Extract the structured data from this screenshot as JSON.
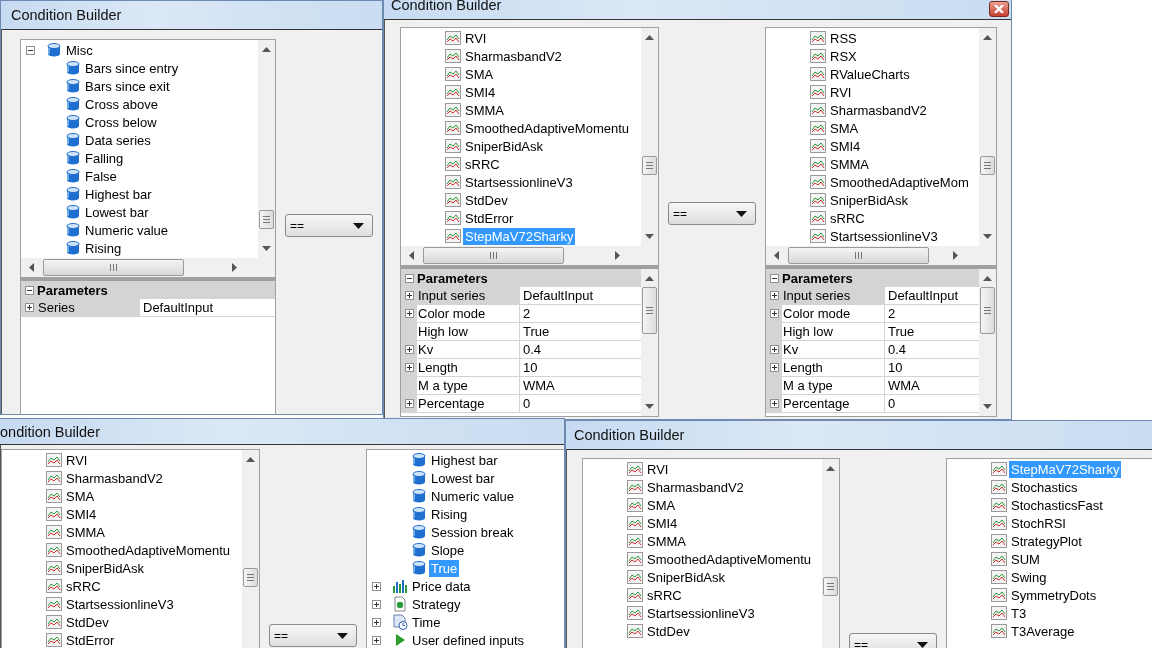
{
  "windows": [
    {
      "title": "Condition Builder",
      "left": {
        "tree": [
          {
            "label": "Misc",
            "kind": "misc",
            "expanded": true,
            "selected": false,
            "children": [
              {
                "label": "Bars since entry",
                "kind": "misc",
                "selected": false
              },
              {
                "label": "Bars since exit",
                "kind": "misc",
                "selected": false
              },
              {
                "label": "Cross above",
                "kind": "misc",
                "selected": false
              },
              {
                "label": "Cross below",
                "kind": "misc",
                "selected": false
              },
              {
                "label": "Data series",
                "kind": "misc",
                "selected": false
              },
              {
                "label": "Falling",
                "kind": "misc",
                "selected": false
              },
              {
                "label": "False",
                "kind": "misc",
                "selected": false
              },
              {
                "label": "Highest bar",
                "kind": "misc",
                "selected": false
              },
              {
                "label": "Lowest bar",
                "kind": "misc",
                "selected": false
              },
              {
                "label": "Numeric value",
                "kind": "misc",
                "selected": false
              },
              {
                "label": "Rising",
                "kind": "misc",
                "selected": false
              }
            ]
          }
        ],
        "parameters": {
          "heading": "Parameters",
          "expanded": true,
          "rows": [
            {
              "name": "Series",
              "value": "DefaultInput",
              "expandable": true,
              "selected": true
            }
          ]
        }
      },
      "operator": "=="
    },
    {
      "title": "Condition Builder",
      "close_button": true,
      "left": {
        "tree": [
          {
            "children": [
              {
                "label": "RVI",
                "kind": "indicator",
                "selected": false
              },
              {
                "label": "SharmasbandV2",
                "kind": "indicator",
                "selected": false
              },
              {
                "label": "SMA",
                "kind": "indicator",
                "selected": false
              },
              {
                "label": "SMI4",
                "kind": "indicator",
                "selected": false
              },
              {
                "label": "SMMA",
                "kind": "indicator",
                "selected": false
              },
              {
                "label": "SmoothedAdaptiveMomentu",
                "kind": "indicator",
                "selected": false
              },
              {
                "label": "SniperBidAsk",
                "kind": "indicator",
                "selected": false
              },
              {
                "label": "sRRC",
                "kind": "indicator",
                "selected": false
              },
              {
                "label": "StartsessionlineV3",
                "kind": "indicator",
                "selected": false
              },
              {
                "label": "StdDev",
                "kind": "indicator",
                "selected": false
              },
              {
                "label": "StdError",
                "kind": "indicator",
                "selected": false
              },
              {
                "label": "StepMaV72Sharky",
                "kind": "indicator",
                "selected": true
              }
            ]
          }
        ],
        "parameters": {
          "heading": "Parameters",
          "expanded": true,
          "rows": [
            {
              "name": "Input series",
              "value": "DefaultInput",
              "expandable": true,
              "selected": true
            },
            {
              "name": "Color mode",
              "value": "2",
              "expandable": true,
              "selected": false
            },
            {
              "name": "High low",
              "value": "True",
              "expandable": false,
              "selected": false
            },
            {
              "name": "Kv",
              "value": "0.4",
              "expandable": true,
              "selected": false
            },
            {
              "name": "Length",
              "value": "10",
              "expandable": true,
              "selected": false
            },
            {
              "name": "M a type",
              "value": "WMA",
              "expandable": false,
              "selected": false
            },
            {
              "name": "Percentage",
              "value": "0",
              "expandable": true,
              "selected": false
            }
          ]
        }
      },
      "operator": "==",
      "right": {
        "tree": [
          {
            "children": [
              {
                "label": "RSS",
                "kind": "indicator",
                "selected": false
              },
              {
                "label": "RSX",
                "kind": "indicator",
                "selected": false
              },
              {
                "label": "RValueCharts",
                "kind": "indicator",
                "selected": false
              },
              {
                "label": "RVI",
                "kind": "indicator",
                "selected": false
              },
              {
                "label": "SharmasbandV2",
                "kind": "indicator",
                "selected": false
              },
              {
                "label": "SMA",
                "kind": "indicator",
                "selected": false
              },
              {
                "label": "SMI4",
                "kind": "indicator",
                "selected": false
              },
              {
                "label": "SMMA",
                "kind": "indicator",
                "selected": false
              },
              {
                "label": "SmoothedAdaptiveMom",
                "kind": "indicator",
                "selected": false
              },
              {
                "label": "SniperBidAsk",
                "kind": "indicator",
                "selected": false
              },
              {
                "label": "sRRC",
                "kind": "indicator",
                "selected": false
              },
              {
                "label": "StartsessionlineV3",
                "kind": "indicator",
                "selected": false
              }
            ]
          }
        ],
        "parameters": {
          "heading": "Parameters",
          "expanded": true,
          "rows": [
            {
              "name": "Input series",
              "value": "DefaultInput",
              "expandable": true,
              "selected": true
            },
            {
              "name": "Color mode",
              "value": "2",
              "expandable": true,
              "selected": false
            },
            {
              "name": "High low",
              "value": "True",
              "expandable": false,
              "selected": false
            },
            {
              "name": "Kv",
              "value": "0.4",
              "expandable": true,
              "selected": false
            },
            {
              "name": "Length",
              "value": "10",
              "expandable": true,
              "selected": false
            },
            {
              "name": "M a type",
              "value": "WMA",
              "expandable": false,
              "selected": false
            },
            {
              "name": "Percentage",
              "value": "0",
              "expandable": true,
              "selected": false
            }
          ]
        }
      }
    },
    {
      "title": "ondition Builder",
      "left": {
        "tree": [
          {
            "children": [
              {
                "label": "RVI",
                "kind": "indicator",
                "selected": false
              },
              {
                "label": "SharmasbandV2",
                "kind": "indicator",
                "selected": false
              },
              {
                "label": "SMA",
                "kind": "indicator",
                "selected": false
              },
              {
                "label": "SMI4",
                "kind": "indicator",
                "selected": false
              },
              {
                "label": "SMMA",
                "kind": "indicator",
                "selected": false
              },
              {
                "label": "SmoothedAdaptiveMomentu",
                "kind": "indicator",
                "selected": false
              },
              {
                "label": "SniperBidAsk",
                "kind": "indicator",
                "selected": false
              },
              {
                "label": "sRRC",
                "kind": "indicator",
                "selected": false
              },
              {
                "label": "StartsessionlineV3",
                "kind": "indicator",
                "selected": false
              },
              {
                "label": "StdDev",
                "kind": "indicator",
                "selected": false
              },
              {
                "label": "StdError",
                "kind": "indicator",
                "selected": false
              }
            ]
          }
        ]
      },
      "operator": "==",
      "right": {
        "tree": [
          {
            "children": [
              {
                "label": "Highest bar",
                "kind": "misc",
                "selected": false
              },
              {
                "label": "Lowest bar",
                "kind": "misc",
                "selected": false
              },
              {
                "label": "Numeric value",
                "kind": "misc",
                "selected": false
              },
              {
                "label": "Rising",
                "kind": "misc",
                "selected": false
              },
              {
                "label": "Session break",
                "kind": "misc",
                "selected": false
              },
              {
                "label": "Slope",
                "kind": "misc",
                "selected": false
              },
              {
                "label": "True",
                "kind": "misc",
                "selected": true
              }
            ]
          },
          {
            "label": "Price data",
            "kind": "price",
            "expanded": false,
            "selected": false
          },
          {
            "label": "Strategy",
            "kind": "strategy",
            "expanded": false,
            "selected": false
          },
          {
            "label": "Time",
            "kind": "time",
            "expanded": false,
            "selected": false
          },
          {
            "label": "User defined inputs",
            "kind": "inputs",
            "expanded": false,
            "selected": false
          }
        ]
      }
    },
    {
      "title": "Condition Builder",
      "left": {
        "tree": [
          {
            "children": [
              {
                "label": "RVI",
                "kind": "indicator",
                "selected": false
              },
              {
                "label": "SharmasbandV2",
                "kind": "indicator",
                "selected": false
              },
              {
                "label": "SMA",
                "kind": "indicator",
                "selected": false
              },
              {
                "label": "SMI4",
                "kind": "indicator",
                "selected": false
              },
              {
                "label": "SMMA",
                "kind": "indicator",
                "selected": false
              },
              {
                "label": "SmoothedAdaptiveMomentu",
                "kind": "indicator",
                "selected": false
              },
              {
                "label": "SniperBidAsk",
                "kind": "indicator",
                "selected": false
              },
              {
                "label": "sRRC",
                "kind": "indicator",
                "selected": false
              },
              {
                "label": "StartsessionlineV3",
                "kind": "indicator",
                "selected": false
              },
              {
                "label": "StdDev",
                "kind": "indicator",
                "selected": false
              }
            ]
          }
        ]
      },
      "operator": "==",
      "right": {
        "tree": [
          {
            "children": [
              {
                "label": "StepMaV72Sharky",
                "kind": "indicator",
                "selected": true
              },
              {
                "label": "Stochastics",
                "kind": "indicator",
                "selected": false
              },
              {
                "label": "StochasticsFast",
                "kind": "indicator",
                "selected": false
              },
              {
                "label": "StochRSI",
                "kind": "indicator",
                "selected": false
              },
              {
                "label": "StrategyPlot",
                "kind": "indicator",
                "selected": false
              },
              {
                "label": "SUM",
                "kind": "indicator",
                "selected": false
              },
              {
                "label": "Swing",
                "kind": "indicator",
                "selected": false
              },
              {
                "label": "SymmetryDots",
                "kind": "indicator",
                "selected": false
              },
              {
                "label": "T3",
                "kind": "indicator",
                "selected": false
              },
              {
                "label": "T3Average",
                "kind": "indicator",
                "selected": false
              }
            ]
          }
        ]
      }
    }
  ]
}
